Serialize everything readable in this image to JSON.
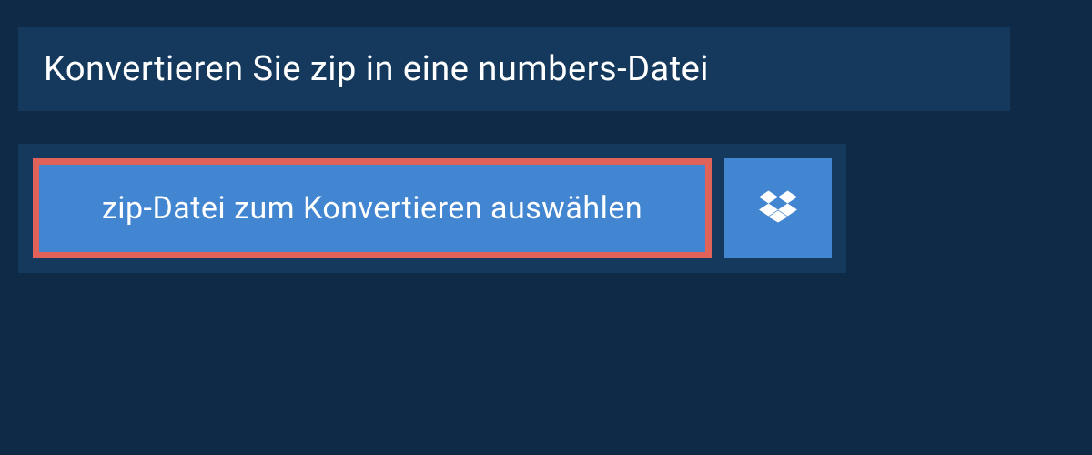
{
  "title": "Konvertieren Sie zip in eine numbers-Datei",
  "select_file_label": "zip-Datei zum Konvertieren auswählen",
  "colors": {
    "background": "#0e2a47",
    "panel": "#14395c",
    "button": "#4285d1",
    "highlight_border": "#e16259",
    "text": "#ffffff"
  }
}
